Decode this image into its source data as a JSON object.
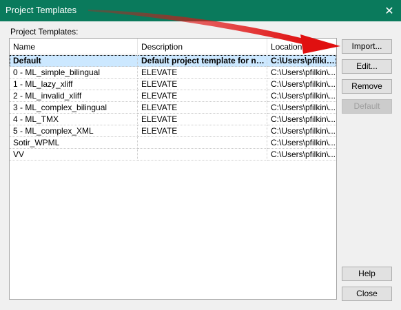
{
  "window": {
    "title": "Project Templates",
    "close_glyph": "✕"
  },
  "group_label": "Project Templates:",
  "columns": [
    "Name",
    "Description",
    "Location"
  ],
  "rows": [
    {
      "name": "Default",
      "description": "Default project template for new...",
      "location": "C:\\Users\\pfilkin\\...",
      "selected": true
    },
    {
      "name": "0 - ML_simple_bilingual",
      "description": "ELEVATE",
      "location": "C:\\Users\\pfilkin\\..."
    },
    {
      "name": "1 - ML_lazy_xliff",
      "description": "ELEVATE",
      "location": "C:\\Users\\pfilkin\\..."
    },
    {
      "name": "2 - ML_invalid_xliff",
      "description": "ELEVATE",
      "location": "C:\\Users\\pfilkin\\..."
    },
    {
      "name": "3 - ML_complex_bilingual",
      "description": "ELEVATE",
      "location": "C:\\Users\\pfilkin\\..."
    },
    {
      "name": "4 - ML_TMX",
      "description": "ELEVATE",
      "location": "C:\\Users\\pfilkin\\..."
    },
    {
      "name": "5 - ML_complex_XML",
      "description": "ELEVATE",
      "location": "C:\\Users\\pfilkin\\..."
    },
    {
      "name": "Sotir_WPML",
      "description": "",
      "location": "C:\\Users\\pfilkin\\..."
    },
    {
      "name": "VV",
      "description": "",
      "location": "C:\\Users\\pfilkin\\..."
    }
  ],
  "buttons": {
    "import": "Import...",
    "edit": "Edit...",
    "remove": "Remove",
    "default": "Default",
    "help": "Help",
    "close": "Close"
  },
  "colors": {
    "titlebar": "#0a7a5c",
    "annotation_arrow": "#e01010",
    "selection": "#cce8ff"
  }
}
